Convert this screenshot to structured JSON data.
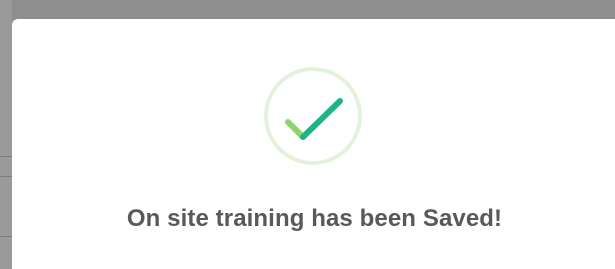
{
  "dialog": {
    "icon": "success-checkmark-icon",
    "message": "On site training has been Saved!"
  },
  "colors": {
    "ring": "#e4f2dc",
    "check": "#1fb38a",
    "check_short": "#8fd36f",
    "text": "#595959"
  }
}
